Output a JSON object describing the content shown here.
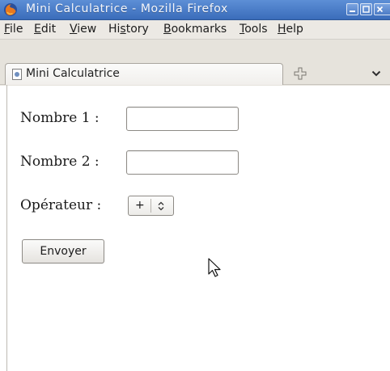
{
  "window": {
    "title": "Mini Calculatrice - Mozilla Firefox",
    "controls": [
      "minimize-icon",
      "maximize-icon",
      "close-icon"
    ],
    "accent": "#3f72c0"
  },
  "menubar": {
    "items": [
      {
        "mnemonic": "F",
        "rest": "ile"
      },
      {
        "mnemonic": "E",
        "rest": "dit"
      },
      {
        "mnemonic": "V",
        "rest": "iew"
      },
      {
        "pre": "Hi",
        "mnemonic": "s",
        "rest": "tory"
      },
      {
        "mnemonic": "B",
        "rest": "ookmarks"
      },
      {
        "mnemonic": "T",
        "rest": "ools"
      },
      {
        "mnemonic": "H",
        "rest": "elp"
      }
    ]
  },
  "tabs": {
    "active_label": "Mini Calculatrice",
    "new_tab_icon": "plus-icon",
    "list_icon": "chevron-down-icon"
  },
  "form": {
    "field1_label": "Nombre 1 :",
    "field1_value": "",
    "field2_label": "Nombre 2 :",
    "field2_value": "",
    "operator_label": "Opérateur :",
    "operator_selected": "+",
    "submit_label": "Envoyer"
  }
}
